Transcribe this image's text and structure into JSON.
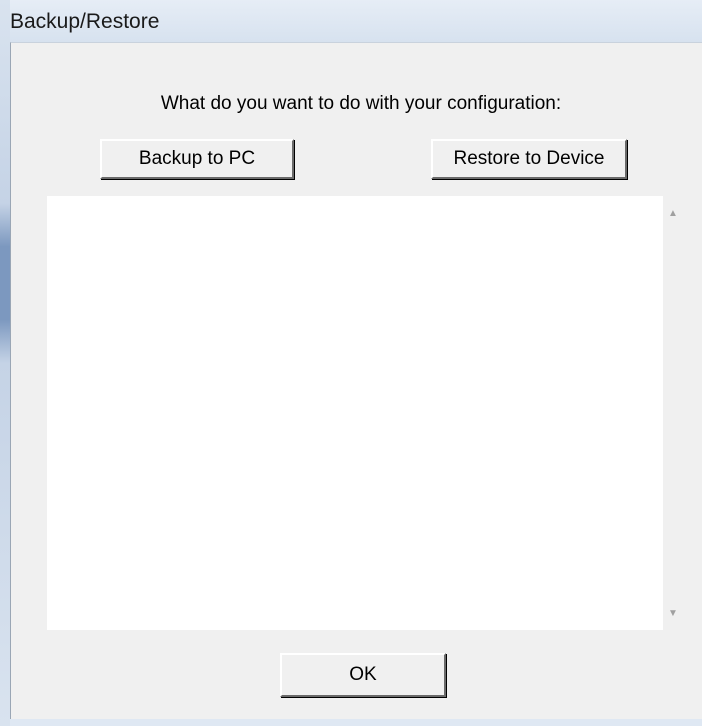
{
  "window": {
    "title": "Backup/Restore"
  },
  "dialog": {
    "prompt": "What do you want to do with your configuration:",
    "backup_label": "Backup to PC",
    "restore_label": "Restore to Device",
    "ok_label": "OK",
    "log_value": ""
  },
  "icons": {
    "scroll_up": "scroll-up-arrow",
    "scroll_down": "scroll-down-arrow"
  },
  "colors": {
    "titlebar": "#dfe8f3",
    "client_bg": "#f0f0f0",
    "log_bg": "#ffffff"
  }
}
